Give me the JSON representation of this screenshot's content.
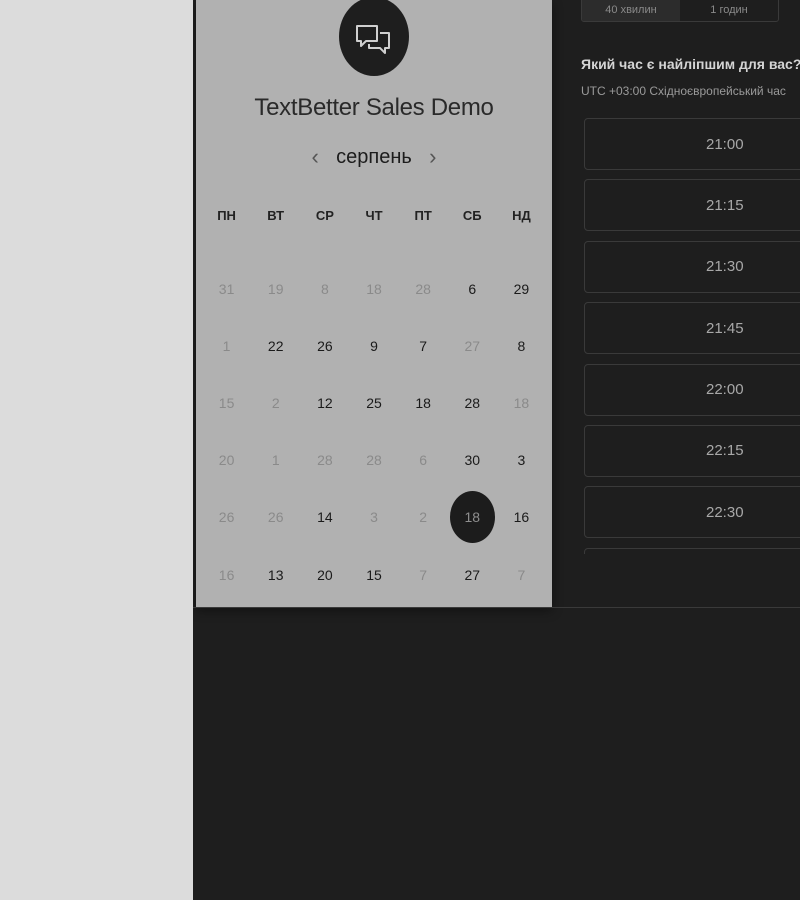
{
  "calendar": {
    "title": "TextBetter Sales Demo",
    "logo_icon": "chat-bubbles-icon",
    "month": "серпень",
    "prev_icon": "chevron-left-icon",
    "next_icon": "chevron-right-icon",
    "weekdays": [
      "ПН",
      "ВТ",
      "СР",
      "ЧТ",
      "ПТ",
      "СБ",
      "НД"
    ],
    "weeks": [
      [
        {
          "d": "31",
          "s": "off"
        },
        {
          "d": "19",
          "s": "off"
        },
        {
          "d": "8",
          "s": "off"
        },
        {
          "d": "18",
          "s": "off"
        },
        {
          "d": "28",
          "s": "off"
        },
        {
          "d": "6",
          "s": "on"
        },
        {
          "d": "29",
          "s": "on"
        }
      ],
      [
        {
          "d": "1",
          "s": "off"
        },
        {
          "d": "22",
          "s": "on"
        },
        {
          "d": "26",
          "s": "on"
        },
        {
          "d": "9",
          "s": "on"
        },
        {
          "d": "7",
          "s": "on"
        },
        {
          "d": "27",
          "s": "off"
        },
        {
          "d": "8",
          "s": "on"
        }
      ],
      [
        {
          "d": "15",
          "s": "off"
        },
        {
          "d": "2",
          "s": "off"
        },
        {
          "d": "12",
          "s": "on"
        },
        {
          "d": "25",
          "s": "on"
        },
        {
          "d": "18",
          "s": "on"
        },
        {
          "d": "28",
          "s": "on"
        },
        {
          "d": "18",
          "s": "off"
        }
      ],
      [
        {
          "d": "20",
          "s": "off"
        },
        {
          "d": "1",
          "s": "off"
        },
        {
          "d": "28",
          "s": "off"
        },
        {
          "d": "28",
          "s": "off"
        },
        {
          "d": "6",
          "s": "off"
        },
        {
          "d": "30",
          "s": "on"
        },
        {
          "d": "3",
          "s": "on"
        }
      ],
      [
        {
          "d": "26",
          "s": "off"
        },
        {
          "d": "26",
          "s": "off"
        },
        {
          "d": "14",
          "s": "on"
        },
        {
          "d": "3",
          "s": "off"
        },
        {
          "d": "2",
          "s": "off"
        },
        {
          "d": "18",
          "s": "sel"
        },
        {
          "d": "16",
          "s": "on"
        }
      ],
      [
        {
          "d": "16",
          "s": "off"
        },
        {
          "d": "13",
          "s": "on"
        },
        {
          "d": "20",
          "s": "on"
        },
        {
          "d": "15",
          "s": "on"
        },
        {
          "d": "7",
          "s": "off"
        },
        {
          "d": "27",
          "s": "on"
        },
        {
          "d": "7",
          "s": "off"
        }
      ]
    ]
  },
  "booking": {
    "durations": [
      "40 хвилин",
      "1 годин"
    ],
    "active_duration": "40 хвилин",
    "question": "Який час є найліпшим для вас?",
    "timezone": "UTC +03:00 Східноєвропейський час",
    "slots": [
      "21:00",
      "21:15",
      "21:30",
      "21:45",
      "22:00",
      "22:15",
      "22:30",
      ""
    ]
  }
}
